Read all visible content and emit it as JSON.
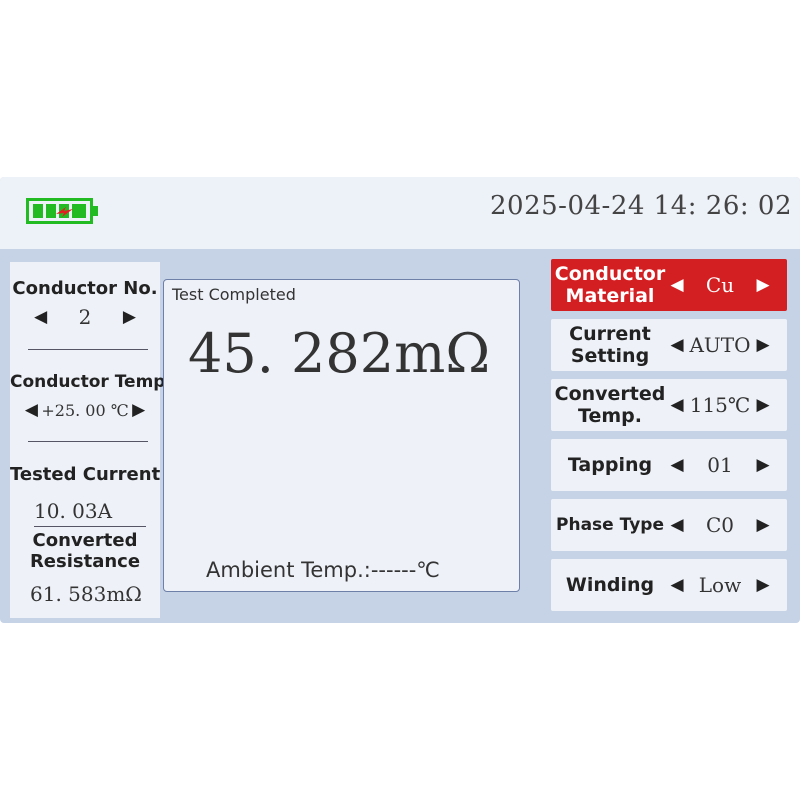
{
  "header": {
    "datetime": "2025-04-24 14: 26: 02"
  },
  "left": {
    "conductor_no": {
      "label": "Conductor No.",
      "value": "2"
    },
    "conductor_temp": {
      "label": "Conductor Temp.",
      "value": "+25. 00 ℃"
    },
    "tested_current": {
      "label": "Tested Current",
      "value": "10. 03A"
    },
    "converted_resistance": {
      "label_line1": "Converted",
      "label_line2": "Resistance",
      "value": "61. 583mΩ"
    }
  },
  "main": {
    "status": "Test Completed",
    "reading": "45. 282mΩ",
    "ambient": "Ambient Temp.:------℃"
  },
  "settings": [
    {
      "label1": "Conductor",
      "label2": "Material",
      "value": "Cu",
      "active": true
    },
    {
      "label1": "Current",
      "label2": "Setting",
      "value": "AUTO",
      "active": false
    },
    {
      "label1": "Converted",
      "label2": "Temp.",
      "value": "115℃",
      "active": false
    },
    {
      "label1": "Tapping",
      "label2": "",
      "value": "01",
      "active": false
    },
    {
      "label1": "Phase Type",
      "label2": "",
      "value": "C0",
      "active": false
    },
    {
      "label1": "Winding",
      "label2": "",
      "value": "Low",
      "active": false
    }
  ],
  "colors": {
    "active_button": "#d41f22",
    "battery": "#22bb22",
    "panel": "#eef2f8",
    "frame": "#c6d3e6"
  },
  "icons": {
    "battery": "battery-charging-icon",
    "arrow_left": "left-arrow-icon",
    "arrow_right": "right-arrow-icon"
  }
}
